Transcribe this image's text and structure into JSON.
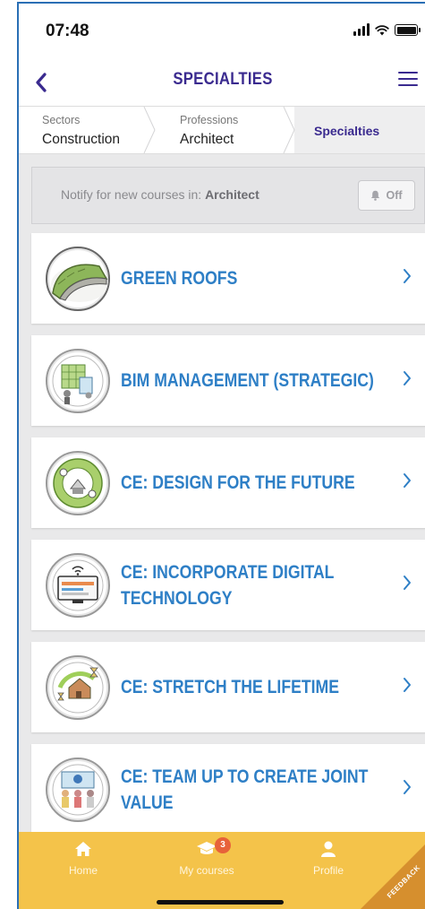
{
  "status_bar": {
    "time": "07:48",
    "icons": [
      "cellular-signal-icon",
      "wifi-icon",
      "battery-icon"
    ]
  },
  "nav": {
    "title": "SPECIALTIES",
    "back_icon": "chevron-left-icon",
    "menu_icon": "hamburger-menu-icon"
  },
  "breadcrumb": {
    "items": [
      {
        "small": "Sectors",
        "label": "Construction"
      },
      {
        "small": "Professions",
        "label": "Architect"
      },
      {
        "label": "Specialties"
      }
    ]
  },
  "notify": {
    "prefix": "Notify for new courses in: ",
    "subject": "Architect",
    "button_label": "Off",
    "button_icon": "bell-icon"
  },
  "specialties": [
    {
      "title": "GREEN ROOFS",
      "icon": "green-roof-illustration"
    },
    {
      "title": "BIM MANAGEMENT (STRATEGIC)",
      "icon": "bim-illustration"
    },
    {
      "title": "CE: DESIGN FOR THE FUTURE",
      "icon": "circular-design-illustration"
    },
    {
      "title": "CE: INCORPORATE DIGITAL TECHNOLOGY",
      "icon": "digital-monitor-illustration"
    },
    {
      "title": "CE: STRETCH THE LIFETIME",
      "icon": "hourglass-house-illustration"
    },
    {
      "title": "CE: TEAM UP TO CREATE JOINT VALUE",
      "icon": "team-illustration"
    }
  ],
  "tabbar": {
    "home": "Home",
    "courses": "My courses",
    "courses_badge": "3",
    "profile": "Profile",
    "feedback": "FEEDBACK"
  },
  "colors": {
    "accent_nav": "#3a2a8f",
    "link_blue": "#2e7fc6",
    "tabbar": "#f4c34a",
    "badge": "#e7623a"
  }
}
